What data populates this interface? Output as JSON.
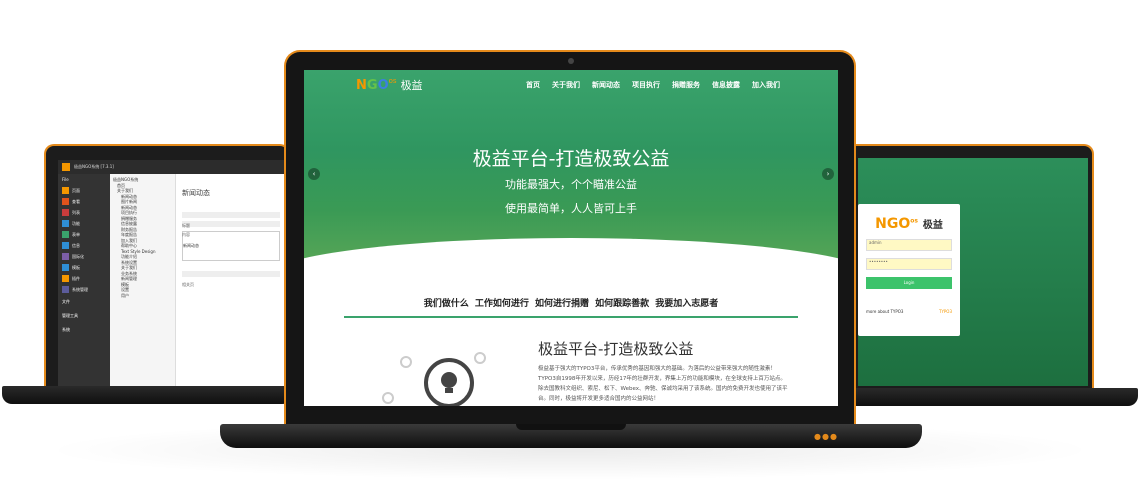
{
  "left_screen": {
    "window_title": "极益NGO系统 [7.3.1]",
    "file_label": "File",
    "modules": [
      "页面",
      "查看",
      "列表",
      "功能",
      "表单",
      "信息",
      "国际化",
      "模板",
      "插件",
      "系统管理"
    ],
    "module_colors": [
      "#f49700",
      "#e0531c",
      "#c83c3c",
      "#2f8fd6",
      "#3aa36c",
      "#2f8fd6",
      "#7b5ea7",
      "#2f8fd6",
      "#f49700",
      "#5c5c9c"
    ],
    "sections": [
      "文件",
      "管理工具",
      "系统"
    ],
    "tree_nodes": [
      "极益NGO系统",
      "首页",
      "关于我们",
      "新闻动态",
      "图片新闻",
      "新闻动态",
      "项目执行",
      "捐赠服务",
      "信息披露",
      "财务报告",
      "年度报告",
      "加入我们",
      "帮助中心",
      "Text Style Design",
      "功能介绍",
      "系统设置",
      "关于我们",
      "业务系统",
      "新闻管理",
      "模板",
      "设置",
      "用户"
    ],
    "content_title": "新闻动态",
    "labels": [
      "标题",
      "内容",
      "新闻动态",
      "相关页"
    ]
  },
  "right_screen": {
    "logo_ngo": "NGO",
    "logo_os": "os",
    "logo_name": "极益",
    "username": "admin",
    "password": "••••••••",
    "login_button": "Login",
    "footer_text": "more about TYPO3",
    "footer_brand": "TYPO3"
  },
  "center_screen": {
    "logo": {
      "n": "N",
      "g": "G",
      "o": "O",
      "os": "os",
      "name": "极益"
    },
    "menu": [
      "首页",
      "关于我们",
      "新闻动态",
      "项目执行",
      "捐赠服务",
      "信息披露",
      "加入我们"
    ],
    "hero_title": "极益平台-打造极致公益",
    "hero_line1": "功能最强大，个个瞄准公益",
    "hero_line2": "使用最简单，人人皆可上手",
    "prev_arrow": "‹",
    "next_arrow": "›",
    "feature_tabs": "我们做什么 工作如何进行 如何进行捐赠 如何跟踪善款 我要加入志愿者",
    "article_title": "极益平台-打造极致公益",
    "article_body": "极益基于强大的TYPO3平台，传承优秀的基因和强大的基础。为落后的公益带来强大的随性激素！TYPO3自1998年开发以来，历经17年的壮群开发，界集上万的功能和模块，在全球支持上百万站点。除去国教科文组织、索尼、松下、Webex、奔驰、保诚均采用了该系统。国内的免费开发也使用了该平台。同时，极益将开发更多适合国内的公益网站！"
  },
  "colors": {
    "accent": "#e48a1b",
    "green": "#3aa36c",
    "orange": "#f49700"
  }
}
